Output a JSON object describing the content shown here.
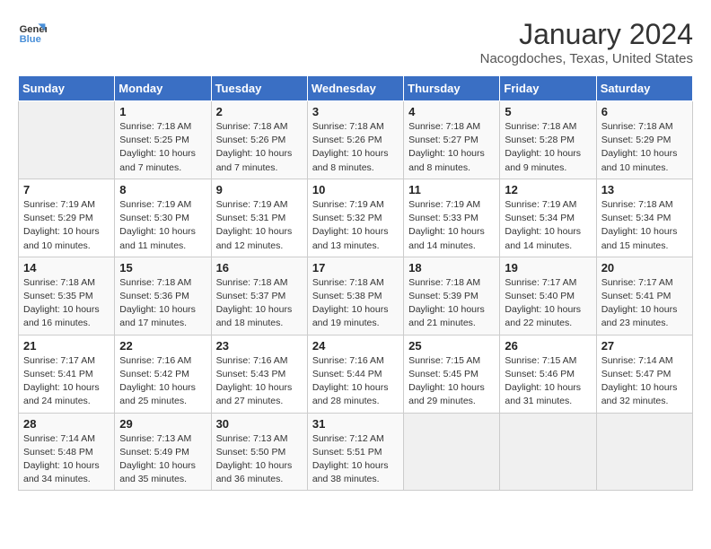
{
  "logo": {
    "line1": "General",
    "line2": "Blue"
  },
  "title": "January 2024",
  "subtitle": "Nacogdoches, Texas, United States",
  "weekdays": [
    "Sunday",
    "Monday",
    "Tuesday",
    "Wednesday",
    "Thursday",
    "Friday",
    "Saturday"
  ],
  "weeks": [
    [
      {
        "day": "",
        "info": ""
      },
      {
        "day": "1",
        "info": "Sunrise: 7:18 AM\nSunset: 5:25 PM\nDaylight: 10 hours\nand 7 minutes."
      },
      {
        "day": "2",
        "info": "Sunrise: 7:18 AM\nSunset: 5:26 PM\nDaylight: 10 hours\nand 7 minutes."
      },
      {
        "day": "3",
        "info": "Sunrise: 7:18 AM\nSunset: 5:26 PM\nDaylight: 10 hours\nand 8 minutes."
      },
      {
        "day": "4",
        "info": "Sunrise: 7:18 AM\nSunset: 5:27 PM\nDaylight: 10 hours\nand 8 minutes."
      },
      {
        "day": "5",
        "info": "Sunrise: 7:18 AM\nSunset: 5:28 PM\nDaylight: 10 hours\nand 9 minutes."
      },
      {
        "day": "6",
        "info": "Sunrise: 7:18 AM\nSunset: 5:29 PM\nDaylight: 10 hours\nand 10 minutes."
      }
    ],
    [
      {
        "day": "7",
        "info": "Sunrise: 7:19 AM\nSunset: 5:29 PM\nDaylight: 10 hours\nand 10 minutes."
      },
      {
        "day": "8",
        "info": "Sunrise: 7:19 AM\nSunset: 5:30 PM\nDaylight: 10 hours\nand 11 minutes."
      },
      {
        "day": "9",
        "info": "Sunrise: 7:19 AM\nSunset: 5:31 PM\nDaylight: 10 hours\nand 12 minutes."
      },
      {
        "day": "10",
        "info": "Sunrise: 7:19 AM\nSunset: 5:32 PM\nDaylight: 10 hours\nand 13 minutes."
      },
      {
        "day": "11",
        "info": "Sunrise: 7:19 AM\nSunset: 5:33 PM\nDaylight: 10 hours\nand 14 minutes."
      },
      {
        "day": "12",
        "info": "Sunrise: 7:19 AM\nSunset: 5:34 PM\nDaylight: 10 hours\nand 14 minutes."
      },
      {
        "day": "13",
        "info": "Sunrise: 7:18 AM\nSunset: 5:34 PM\nDaylight: 10 hours\nand 15 minutes."
      }
    ],
    [
      {
        "day": "14",
        "info": "Sunrise: 7:18 AM\nSunset: 5:35 PM\nDaylight: 10 hours\nand 16 minutes."
      },
      {
        "day": "15",
        "info": "Sunrise: 7:18 AM\nSunset: 5:36 PM\nDaylight: 10 hours\nand 17 minutes."
      },
      {
        "day": "16",
        "info": "Sunrise: 7:18 AM\nSunset: 5:37 PM\nDaylight: 10 hours\nand 18 minutes."
      },
      {
        "day": "17",
        "info": "Sunrise: 7:18 AM\nSunset: 5:38 PM\nDaylight: 10 hours\nand 19 minutes."
      },
      {
        "day": "18",
        "info": "Sunrise: 7:18 AM\nSunset: 5:39 PM\nDaylight: 10 hours\nand 21 minutes."
      },
      {
        "day": "19",
        "info": "Sunrise: 7:17 AM\nSunset: 5:40 PM\nDaylight: 10 hours\nand 22 minutes."
      },
      {
        "day": "20",
        "info": "Sunrise: 7:17 AM\nSunset: 5:41 PM\nDaylight: 10 hours\nand 23 minutes."
      }
    ],
    [
      {
        "day": "21",
        "info": "Sunrise: 7:17 AM\nSunset: 5:41 PM\nDaylight: 10 hours\nand 24 minutes."
      },
      {
        "day": "22",
        "info": "Sunrise: 7:16 AM\nSunset: 5:42 PM\nDaylight: 10 hours\nand 25 minutes."
      },
      {
        "day": "23",
        "info": "Sunrise: 7:16 AM\nSunset: 5:43 PM\nDaylight: 10 hours\nand 27 minutes."
      },
      {
        "day": "24",
        "info": "Sunrise: 7:16 AM\nSunset: 5:44 PM\nDaylight: 10 hours\nand 28 minutes."
      },
      {
        "day": "25",
        "info": "Sunrise: 7:15 AM\nSunset: 5:45 PM\nDaylight: 10 hours\nand 29 minutes."
      },
      {
        "day": "26",
        "info": "Sunrise: 7:15 AM\nSunset: 5:46 PM\nDaylight: 10 hours\nand 31 minutes."
      },
      {
        "day": "27",
        "info": "Sunrise: 7:14 AM\nSunset: 5:47 PM\nDaylight: 10 hours\nand 32 minutes."
      }
    ],
    [
      {
        "day": "28",
        "info": "Sunrise: 7:14 AM\nSunset: 5:48 PM\nDaylight: 10 hours\nand 34 minutes."
      },
      {
        "day": "29",
        "info": "Sunrise: 7:13 AM\nSunset: 5:49 PM\nDaylight: 10 hours\nand 35 minutes."
      },
      {
        "day": "30",
        "info": "Sunrise: 7:13 AM\nSunset: 5:50 PM\nDaylight: 10 hours\nand 36 minutes."
      },
      {
        "day": "31",
        "info": "Sunrise: 7:12 AM\nSunset: 5:51 PM\nDaylight: 10 hours\nand 38 minutes."
      },
      {
        "day": "",
        "info": ""
      },
      {
        "day": "",
        "info": ""
      },
      {
        "day": "",
        "info": ""
      }
    ]
  ]
}
